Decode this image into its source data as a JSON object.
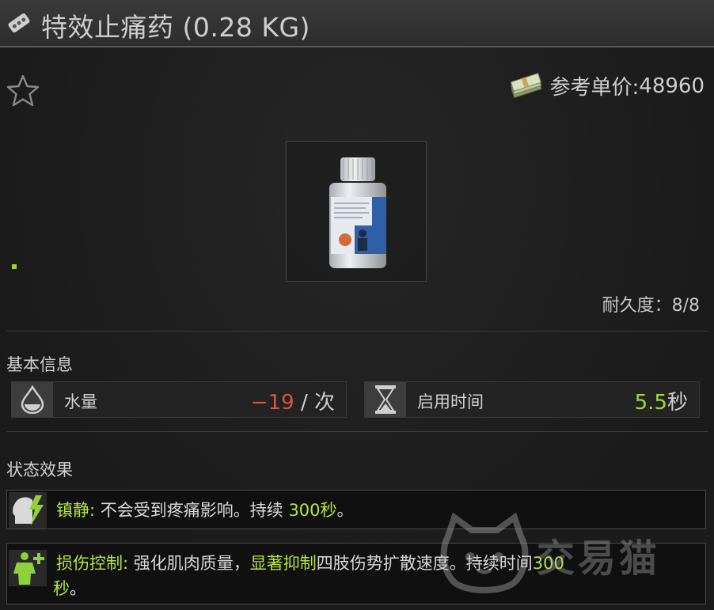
{
  "header": {
    "title": "特效止痛药 (0.28 KG)",
    "icon": "pill-pack-icon"
  },
  "favorite": {
    "icon": "star-icon"
  },
  "price": {
    "icon": "money-stack-icon",
    "label": "参考单价:",
    "value": "48960"
  },
  "item": {
    "image": "pill-bottle",
    "durability": "耐久度：8/8"
  },
  "basic_info": {
    "title": "基本信息",
    "stats": [
      {
        "icon": "water-drop-icon",
        "label": "水量",
        "value": "−19",
        "unit": " / 次",
        "value_color": "#d05a3a"
      },
      {
        "icon": "hourglass-icon",
        "label": "启用时间",
        "value": "5.5",
        "unit": "秒",
        "value_color": "#a6d63a"
      }
    ]
  },
  "status_effects": {
    "title": "状态效果",
    "effects": [
      {
        "icon": "head-lightning-icon",
        "name": "镇静:",
        "text_a": " 不会受到疼痛影响。持续 ",
        "highlight_a": "300秒",
        "text_b": "。"
      },
      {
        "icon": "body-plus-icon",
        "name": "损伤控制:",
        "text_a": " 强化肌肉质量，",
        "highlight_a": "显著抑制",
        "text_b": "四肢伤势扩散速度。持续时间",
        "highlight_b": "300",
        "line2_highlight": "秒",
        "line2_text": "。"
      }
    ]
  },
  "watermark": {
    "text": "交易猫"
  },
  "colors": {
    "accent_green": "#a6d63a",
    "negative_red": "#d05a3a"
  }
}
